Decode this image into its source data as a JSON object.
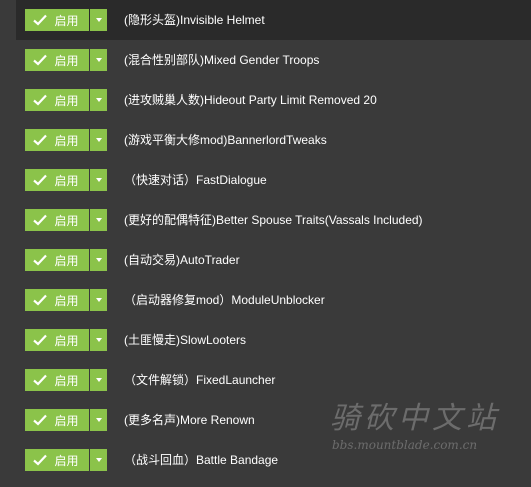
{
  "toggle": {
    "enable_label": "启用",
    "check_icon": "check-icon",
    "dropdown_icon": "chevron-down-icon"
  },
  "colors": {
    "accent_green": "#8bc34a",
    "background": "#3a3a3a",
    "selected_row": "#2a2a2a",
    "text": "#ffffff"
  },
  "mods": [
    {
      "name": "(隐形头盔)Invisible Helmet",
      "enabled": true,
      "selected": true
    },
    {
      "name": "(混合性别部队)Mixed Gender Troops",
      "enabled": true,
      "selected": false
    },
    {
      "name": "(进攻贼巢人数)Hideout Party Limit Removed 20",
      "enabled": true,
      "selected": false
    },
    {
      "name": "(游戏平衡大修mod)BannerlordTweaks",
      "enabled": true,
      "selected": false
    },
    {
      "name": "（快速对话）FastDialogue",
      "enabled": true,
      "selected": false
    },
    {
      "name": "(更好的配偶特征)Better Spouse Traits(Vassals Included)",
      "enabled": true,
      "selected": false
    },
    {
      "name": "(自动交易)AutoTrader",
      "enabled": true,
      "selected": false
    },
    {
      "name": "（启动器修复mod）ModuleUnblocker",
      "enabled": true,
      "selected": false
    },
    {
      "name": "(土匪慢走)SlowLooters",
      "enabled": true,
      "selected": false
    },
    {
      "name": "（文件解锁）FixedLauncher",
      "enabled": true,
      "selected": false
    },
    {
      "name": "(更多名声)More Renown",
      "enabled": true,
      "selected": false
    },
    {
      "name": "（战斗回血）Battle Bandage",
      "enabled": true,
      "selected": false
    }
  ],
  "watermark": {
    "logo_text": "骑砍中文站",
    "url": "bbs.mountblade.com.cn"
  }
}
